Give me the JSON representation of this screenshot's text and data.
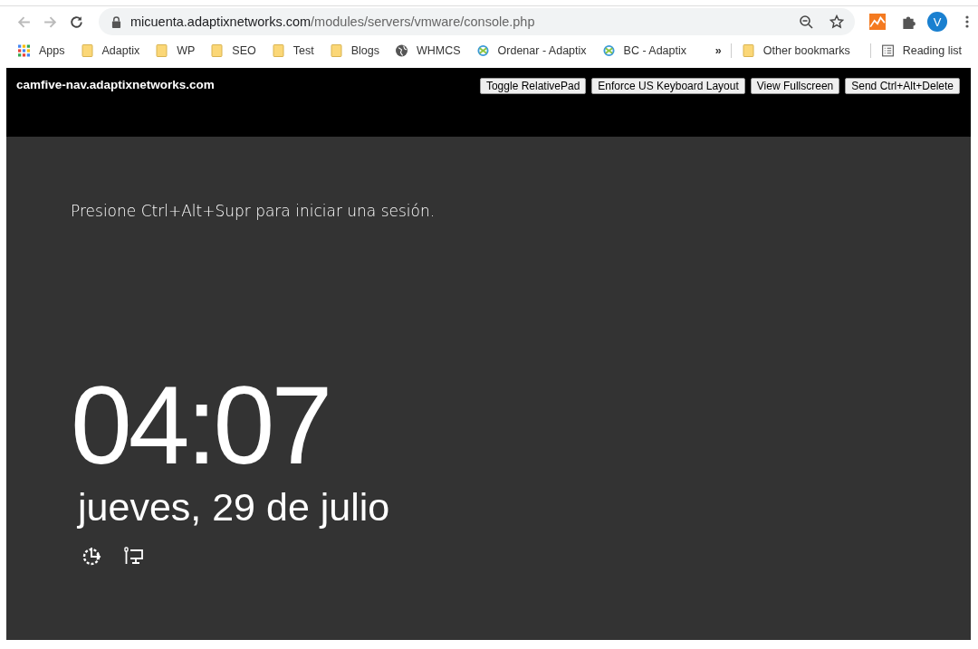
{
  "browser": {
    "url_host": "micuenta.adaptixnetworks.com",
    "url_path": "/modules/servers/vmware/console.php",
    "avatar": "V",
    "bookmarks": [
      {
        "label": "Apps",
        "kind": "apps"
      },
      {
        "label": "Adaptix",
        "kind": "folder"
      },
      {
        "label": "WP",
        "kind": "folder"
      },
      {
        "label": "SEO",
        "kind": "folder"
      },
      {
        "label": "Test",
        "kind": "folder"
      },
      {
        "label": "Blogs",
        "kind": "folder"
      },
      {
        "label": "WHMCS",
        "kind": "globe"
      },
      {
        "label": "Ordenar - Adaptix",
        "kind": "site"
      },
      {
        "label": "BC - Adaptix",
        "kind": "site"
      }
    ],
    "more": "»",
    "other_bookmarks": "Other bookmarks",
    "reading_list": "Reading list"
  },
  "console": {
    "host": "camfive-nav.adaptixnetworks.com",
    "buttons": [
      "Toggle RelativePad",
      "Enforce US Keyboard Layout",
      "View Fullscreen",
      "Send Ctrl+Alt+Delete"
    ],
    "prompt": "Presione Ctrl+Alt+Supr para iniciar una sesión.",
    "time": "04:07",
    "date": "jueves, 29 de julio"
  }
}
